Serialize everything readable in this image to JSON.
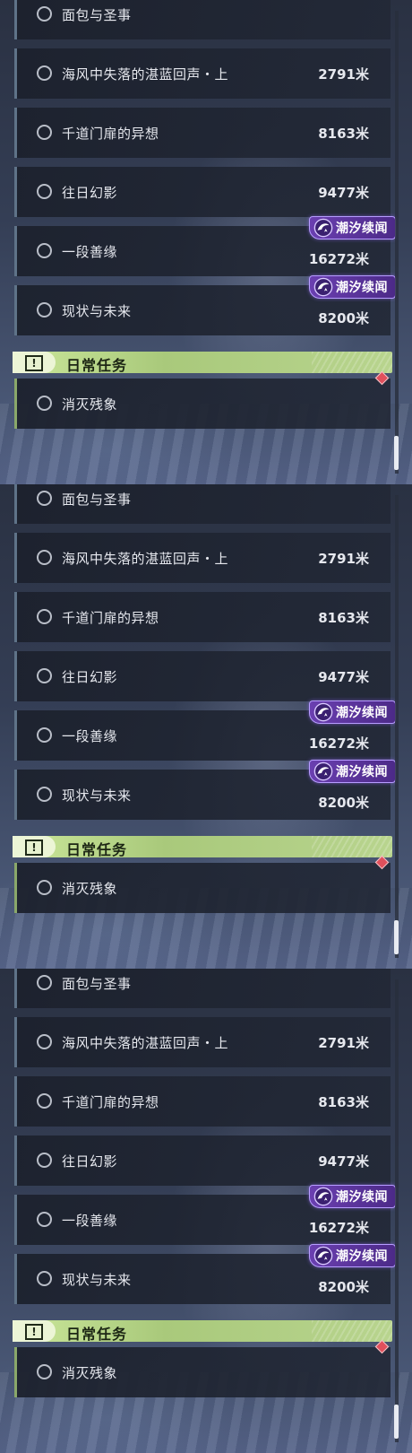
{
  "quests": [
    {
      "title": "面包与圣事",
      "distance": ""
    },
    {
      "title": "海风中失落的湛蓝回声・上",
      "distance": "2791米"
    },
    {
      "title": "千道门扉的异想",
      "distance": "8163米"
    },
    {
      "title": "往日幻影",
      "distance": "9477米"
    },
    {
      "title": "一段善缘",
      "distance": "16272米",
      "badge": "潮汐续闻"
    },
    {
      "title": "现状与未来",
      "distance": "8200米",
      "badge": "潮汐续闻"
    }
  ],
  "daily_section": {
    "title": "日常任务",
    "icon": "exclamation-icon",
    "quests": [
      {
        "title": "消灭残象"
      }
    ]
  },
  "badge_icon": "tidal-swirl-icon",
  "colors": {
    "badge_purple": "#6a3fb0",
    "section_green": "#b8d48e",
    "tracked_marker": "#e0505c"
  }
}
